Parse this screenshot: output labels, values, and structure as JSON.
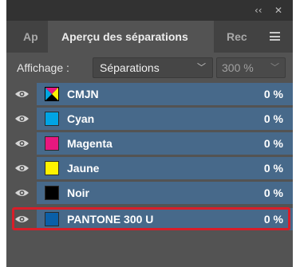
{
  "titlebar": {
    "collapse_glyph": "‹‹",
    "close_glyph": "✕"
  },
  "tabs": [
    {
      "label": "Ap"
    },
    {
      "label": "Aperçu des séparations"
    },
    {
      "label": "Rec"
    }
  ],
  "view": {
    "label": "Affichage :",
    "mode": "Séparations",
    "zoom": "300 %"
  },
  "separations": [
    {
      "name": "CMJN",
      "percent": "0 %",
      "swatch": "cmyk",
      "color": "#00a6e0",
      "visible": true
    },
    {
      "name": "Cyan",
      "percent": "0 %",
      "swatch": "solid",
      "color": "#00a4e4",
      "visible": true
    },
    {
      "name": "Magenta",
      "percent": "0 %",
      "swatch": "solid",
      "color": "#e8177f",
      "visible": true
    },
    {
      "name": "Jaune",
      "percent": "0 %",
      "swatch": "solid",
      "color": "#fff200",
      "visible": true
    },
    {
      "name": "Noir",
      "percent": "0 %",
      "swatch": "solid",
      "color": "#000000",
      "visible": true
    },
    {
      "name": "PANTONE 300 U",
      "percent": "0 %",
      "swatch": "solid",
      "color": "#0a5fa8",
      "visible": true
    }
  ],
  "highlighted_row": "PANTONE 300 U",
  "colors": {
    "row_bg": "#47698a",
    "panel_bg": "#535353",
    "highlight_border": "#d81e29"
  }
}
